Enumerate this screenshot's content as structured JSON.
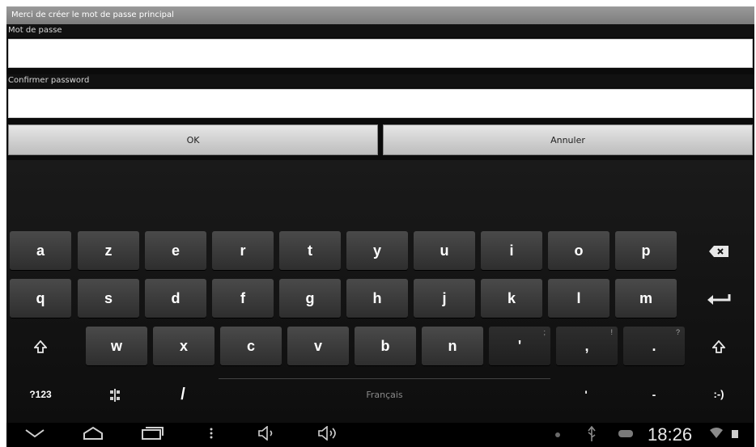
{
  "dialog": {
    "title": "Merci de créer le mot de passe principal",
    "password_label": "Mot de passe",
    "password_value": "",
    "confirm_label": "Confirmer password",
    "confirm_value": "",
    "ok_label": "OK",
    "cancel_label": "Annuler"
  },
  "keyboard": {
    "row1": [
      "a",
      "z",
      "e",
      "r",
      "t",
      "y",
      "u",
      "i",
      "o",
      "p"
    ],
    "row2": [
      "q",
      "s",
      "d",
      "f",
      "g",
      "h",
      "j",
      "k",
      "l",
      "m"
    ],
    "row3": [
      "w",
      "x",
      "c",
      "v",
      "b",
      "n",
      "'",
      ",",
      "."
    ],
    "row3_hints": [
      "",
      "",
      "",
      "",
      "",
      "",
      ";",
      "!",
      "?"
    ],
    "sym_label": "?123",
    "slash_label": "/",
    "space_label": "Français",
    "emoji_label": ":-)",
    "apostrophe_label": "'",
    "dash_label": "-"
  },
  "statusbar": {
    "time": "18:26"
  }
}
